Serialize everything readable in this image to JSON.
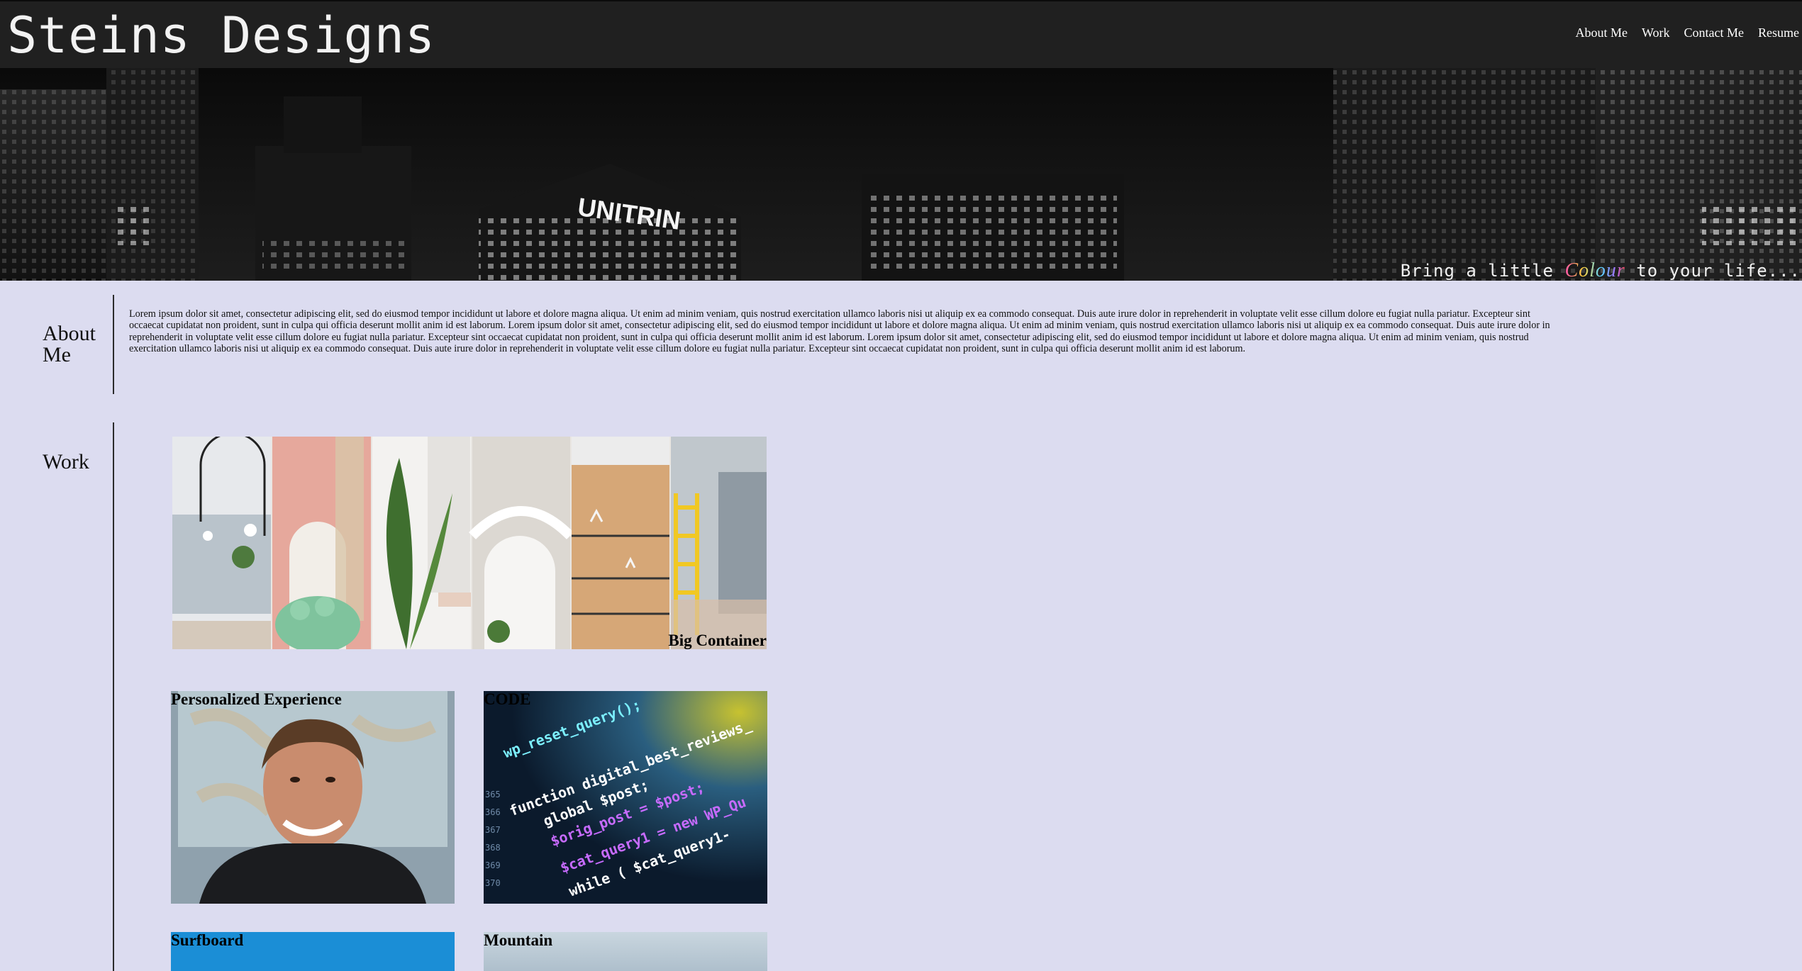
{
  "header": {
    "site_title": "Steins Designs",
    "nav": [
      "About Me",
      "Work",
      "Contact Me",
      "Resume"
    ]
  },
  "hero": {
    "building_sign": "UNITRIN",
    "tagline_before": "Bring a little ",
    "tagline_colour": "Colour",
    "tagline_after": " to your life..."
  },
  "about": {
    "label": "About Me",
    "text": "Lorem ipsum dolor sit amet, consectetur adipiscing elit, sed do eiusmod tempor incididunt ut labore et dolore magna aliqua. Ut enim ad minim veniam, quis nostrud exercitation ullamco laboris nisi ut aliquip ex ea commodo consequat. Duis aute irure dolor in reprehenderit in voluptate velit esse cillum dolore eu fugiat nulla pariatur. Excepteur sint occaecat cupidatat non proident, sunt in culpa qui officia deserunt mollit anim id est laborum. Lorem ipsum dolor sit amet, consectetur adipiscing elit, sed do eiusmod tempor incididunt ut labore et dolore magna aliqua. Ut enim ad minim veniam, quis nostrud exercitation ullamco laboris nisi ut aliquip ex ea commodo consequat. Duis aute irure dolor in reprehenderit in voluptate velit esse cillum dolore eu fugiat nulla pariatur. Excepteur sint occaecat cupidatat non proident, sunt in culpa qui officia deserunt mollit anim id est laborum. Lorem ipsum dolor sit amet, consectetur adipiscing elit, sed do eiusmod tempor incididunt ut labore et dolore magna aliqua. Ut enim ad minim veniam, quis nostrud exercitation ullamco laboris nisi ut aliquip ex ea commodo consequat. Duis aute irure dolor in reprehenderit in voluptate velit esse cillum dolore eu fugiat nulla pariatur. Excepteur sint occaecat cupidatat non proident, sunt in culpa qui officia deserunt mollit anim id est laborum."
  },
  "work": {
    "label": "Work",
    "projects": {
      "big_container": "Big Container",
      "personalized": "Personalized Experience",
      "code": "CODE",
      "surfboard": "Surfboard",
      "mountain": "Mountain"
    }
  },
  "code_lines": [
    "function digital_best_reviews_",
    "global $post;",
    "$orig_post = $post;",
    "$cat_query1 = new WP_Qu",
    "while ( $cat_query1-",
    "wp_reset_query();"
  ],
  "colors": {
    "header_bg": "#202020",
    "page_bg": "#dcdcf0",
    "text": "#111111"
  }
}
